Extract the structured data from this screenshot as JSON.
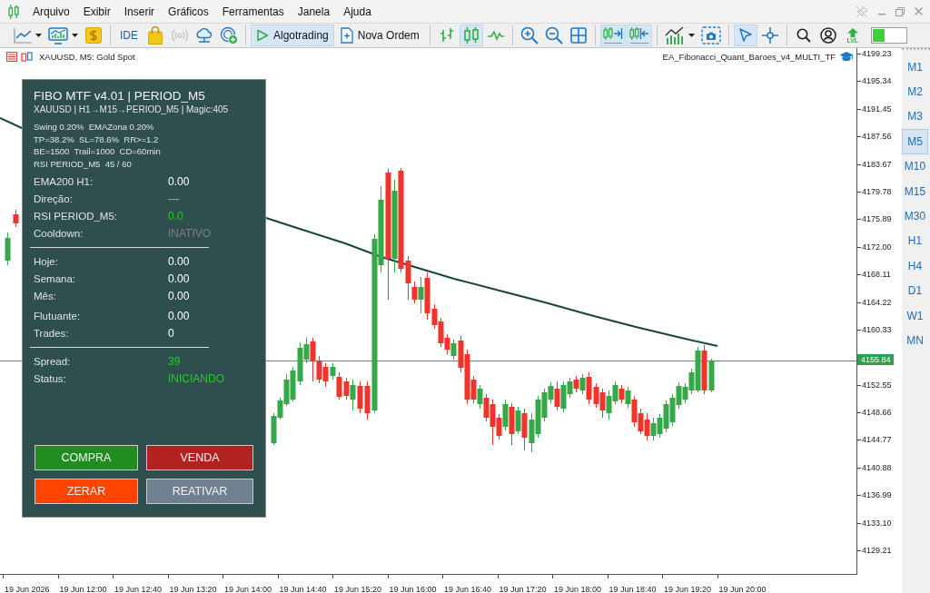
{
  "menu": {
    "items": [
      "Arquivo",
      "Exibir",
      "Inserir",
      "Gráficos",
      "Ferramentas",
      "Janela",
      "Ajuda"
    ]
  },
  "toolbar": {
    "groups": [
      {
        "items": [
          {
            "kind": "dropdown",
            "selected": false,
            "disabled": false
          },
          {
            "kind": "dropdown",
            "selected": false,
            "disabled": false
          },
          {
            "kind": "icon",
            "selected": false,
            "disabled": false
          }
        ]
      },
      {
        "items": [
          {
            "kind": "text",
            "label": "IDE",
            "selected": false,
            "disabled": false
          },
          {
            "kind": "icon",
            "selected": false,
            "disabled": false
          },
          {
            "kind": "icon",
            "selected": false,
            "disabled": true
          },
          {
            "kind": "icon",
            "selected": false,
            "disabled": false
          },
          {
            "kind": "icon",
            "selected": false,
            "disabled": false
          }
        ]
      },
      {
        "items": [
          {
            "kind": "labeled",
            "label": "Algotrading",
            "selected": true,
            "disabled": false
          },
          {
            "kind": "labeled",
            "label": "Nova Ordem",
            "selected": false,
            "disabled": false
          }
        ]
      },
      {
        "items": [
          {
            "kind": "icon",
            "selected": false,
            "disabled": false
          },
          {
            "kind": "icon",
            "selected": true,
            "disabled": false
          },
          {
            "kind": "icon",
            "selected": false,
            "disabled": false
          }
        ]
      },
      {
        "items": [
          {
            "kind": "icon",
            "selected": false,
            "disabled": false
          },
          {
            "kind": "icon",
            "selected": false,
            "disabled": false
          },
          {
            "kind": "icon",
            "selected": false,
            "disabled": false
          }
        ]
      },
      {
        "items": [
          {
            "kind": "icon",
            "selected": true,
            "disabled": false
          },
          {
            "kind": "icon",
            "selected": true,
            "disabled": false
          }
        ]
      },
      {
        "items": [
          {
            "kind": "dropdown",
            "selected": false,
            "disabled": false
          },
          {
            "kind": "icon",
            "selected": false,
            "disabled": false
          }
        ]
      },
      {
        "items": [
          {
            "kind": "icon",
            "selected": true,
            "disabled": false
          },
          {
            "kind": "icon",
            "selected": false,
            "disabled": false
          }
        ]
      },
      {
        "items": [
          {
            "kind": "icon",
            "selected": false,
            "disabled": false
          },
          {
            "kind": "icon",
            "selected": false,
            "disabled": false
          },
          {
            "kind": "stacked",
            "label": "LVL",
            "selected": false,
            "disabled": false
          }
        ]
      }
    ]
  },
  "chart": {
    "title": "XAUUSD, M5: Gold Spot",
    "expert": "EA_Fibonacci_Quant_Baroes_v4_MULTI_TF",
    "panel": {
      "title": "FIBO MTF v4.01 | PERIOD_M5",
      "subtitle": "XAUUSD | H1→M15→PERIOD_M5 | Magic:405",
      "info": [
        "Swing 0.20%  EMAZona 0.20%",
        "TP=38.2%  SL=78.6%  RR>=1.2",
        "BE=1500  Trail=1000  CD=60min",
        "RSI PERIOD_M5  45 / 60"
      ],
      "sections": [
        {
          "divider": false,
          "rows": [
            {
              "label": "EMA200 H1:",
              "value": "0.00",
              "color": "#ffffff"
            },
            {
              "label": "Direção:",
              "value": "---",
              "color": "#c8c83c"
            },
            {
              "label": "RSI PERIOD_M5:",
              "value": "0.0",
              "color": "#22cc22"
            },
            {
              "label": "Cooldown:",
              "value": "INATIVO",
              "color": "#808080"
            }
          ]
        },
        {
          "divider": true,
          "rows": [
            {
              "label": "Hoje:",
              "value": "0.00",
              "color": "#ffffff"
            },
            {
              "label": "Semana:",
              "value": "0.00",
              "color": "#ffffff"
            },
            {
              "label": "Mês:",
              "value": "0.00",
              "color": "#ffffff"
            }
          ]
        },
        {
          "divider": false,
          "rows": [
            {
              "label": "Flutuante:",
              "value": "0.00",
              "color": "#ffffff"
            },
            {
              "label": "Trades:",
              "value": "0",
              "color": "#ffffff"
            }
          ]
        },
        {
          "divider": true,
          "rows": [
            {
              "label": "Spread:",
              "value": "39",
              "color": "#22cc22"
            },
            {
              "label": "Status:",
              "value": "INICIANDO",
              "color": "#22cc22"
            }
          ]
        }
      ],
      "buttons": [
        {
          "label": "COMPRA",
          "color": "#228b22"
        },
        {
          "label": "VENDA",
          "color": "#b22222"
        },
        {
          "label": "ZERAR",
          "color": "#ff4500"
        },
        {
          "label": "REATIVAR",
          "color": "#708090"
        }
      ]
    },
    "price_axis": {
      "ticks": [
        {
          "kind": "tick",
          "label": "4199.23"
        },
        {
          "kind": "tick",
          "label": "4195.34"
        },
        {
          "kind": "tick",
          "label": "4191.45"
        },
        {
          "kind": "tick",
          "label": "4187.56"
        },
        {
          "kind": "tick",
          "label": "4183.67"
        },
        {
          "kind": "tick",
          "label": "4179.78"
        },
        {
          "kind": "tick",
          "label": "4175.89"
        },
        {
          "kind": "tick",
          "label": "4172.00"
        },
        {
          "kind": "tick",
          "label": "4168.11"
        },
        {
          "kind": "tick",
          "label": "4164.22"
        },
        {
          "kind": "tick",
          "label": "4160.33"
        },
        {
          "kind": "current",
          "label": "4155.84"
        },
        {
          "kind": "tick",
          "label": "4152.55"
        },
        {
          "kind": "tick",
          "label": "4148.66"
        },
        {
          "kind": "tick",
          "label": "4144.77"
        },
        {
          "kind": "tick",
          "label": "4140.88"
        },
        {
          "kind": "tick",
          "label": "4136.99"
        },
        {
          "kind": "tick",
          "label": "4133.10"
        },
        {
          "kind": "tick",
          "label": "4129.21"
        }
      ]
    },
    "time_axis": {
      "labels": [
        "19 Jun 2026",
        "19 Jun 12:00",
        "19 Jun 12:40",
        "19 Jun 13:20",
        "19 Jun 14:00",
        "19 Jun 14:40",
        "19 Jun 15:20",
        "19 Jun 16:00",
        "19 Jun 16:40",
        "19 Jun 17:20",
        "19 Jun 18:00",
        "19 Jun 18:40",
        "19 Jun 19:20",
        "19 Jun 20:00"
      ]
    }
  },
  "timeframes": [
    {
      "label": "M1",
      "selected": false
    },
    {
      "label": "M2",
      "selected": false
    },
    {
      "label": "M3",
      "selected": false
    },
    {
      "label": "M5",
      "selected": true
    },
    {
      "label": "M10",
      "selected": false
    },
    {
      "label": "M15",
      "selected": false
    },
    {
      "label": "M30",
      "selected": false
    },
    {
      "label": "H1",
      "selected": false
    },
    {
      "label": "H4",
      "selected": false
    },
    {
      "label": "D1",
      "selected": false
    },
    {
      "label": "W1",
      "selected": false
    },
    {
      "label": "MN",
      "selected": false
    }
  ]
}
